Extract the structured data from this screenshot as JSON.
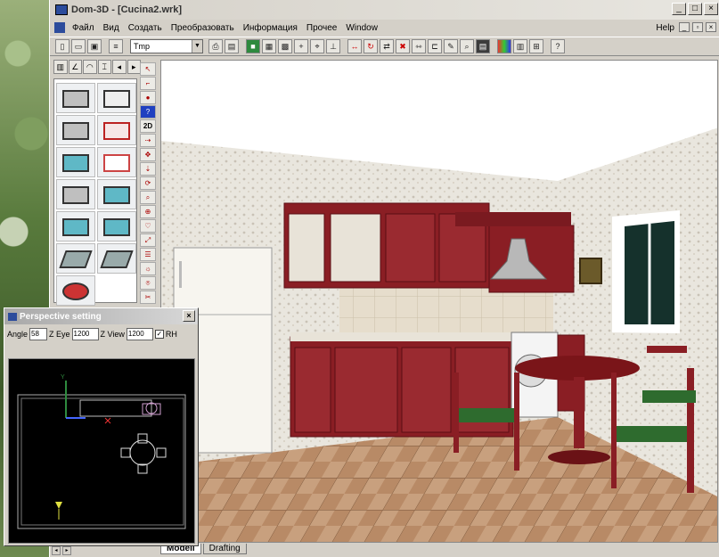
{
  "window": {
    "title": "Dom-3D - [Cucina2.wrk]",
    "min": "_",
    "max": "□",
    "close": "×"
  },
  "menu": [
    "Файл",
    "Вид",
    "Создать",
    "Преобразовать",
    "Информация",
    "Прочее",
    "Window",
    "Help"
  ],
  "toolbar": {
    "layer_dropdown": "Tmp"
  },
  "bottom_tabs": [
    "Modell",
    "Drafting"
  ],
  "dialog": {
    "title": "Perspective setting",
    "angle_label": "Angle",
    "angle_value": "58",
    "zeye_label": "Z Eye",
    "zeye_value": "1200",
    "zview_label": "Z View",
    "zview_value": "1200",
    "rh_label": "RH",
    "rh_checked": "✓"
  },
  "icons": [
    "new-icon",
    "open-icon",
    "save-icon",
    "print-icon",
    "zoom-icon",
    "grid-icon",
    "color-icon",
    "help-icon"
  ],
  "colors": {
    "cabinet": "#8a1e24",
    "wall": "#e7e3da",
    "floor": "#b78d6a",
    "accent": "#2c4c9c"
  }
}
